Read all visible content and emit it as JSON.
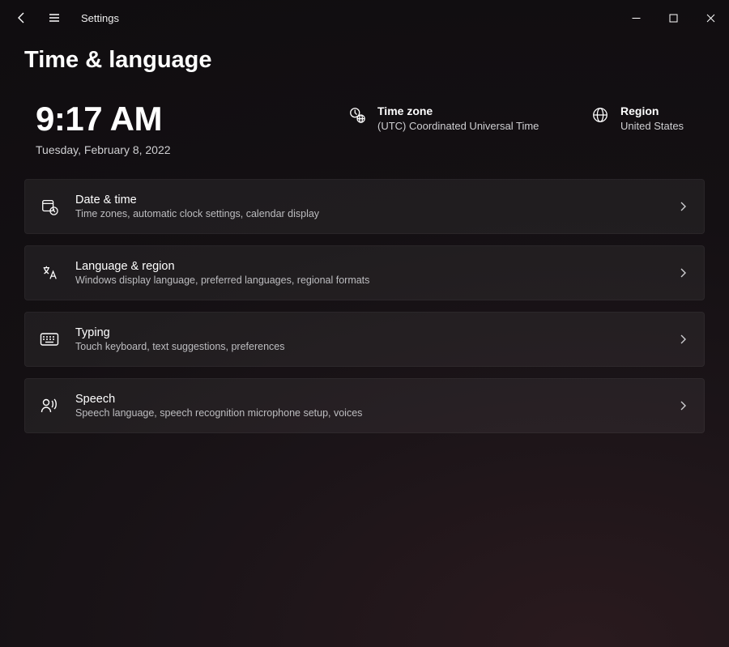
{
  "app_name": "Settings",
  "page_title": "Time & language",
  "clock": {
    "time": "9:17 AM",
    "date": "Tuesday, February 8, 2022"
  },
  "timezone": {
    "label": "Time zone",
    "value": "(UTC) Coordinated Universal Time"
  },
  "region": {
    "label": "Region",
    "value": "United States"
  },
  "cards": [
    {
      "title": "Date & time",
      "sub": "Time zones, automatic clock settings, calendar display"
    },
    {
      "title": "Language & region",
      "sub": "Windows display language, preferred languages, regional formats"
    },
    {
      "title": "Typing",
      "sub": "Touch keyboard, text suggestions, preferences"
    },
    {
      "title": "Speech",
      "sub": "Speech language, speech recognition microphone setup, voices"
    }
  ]
}
